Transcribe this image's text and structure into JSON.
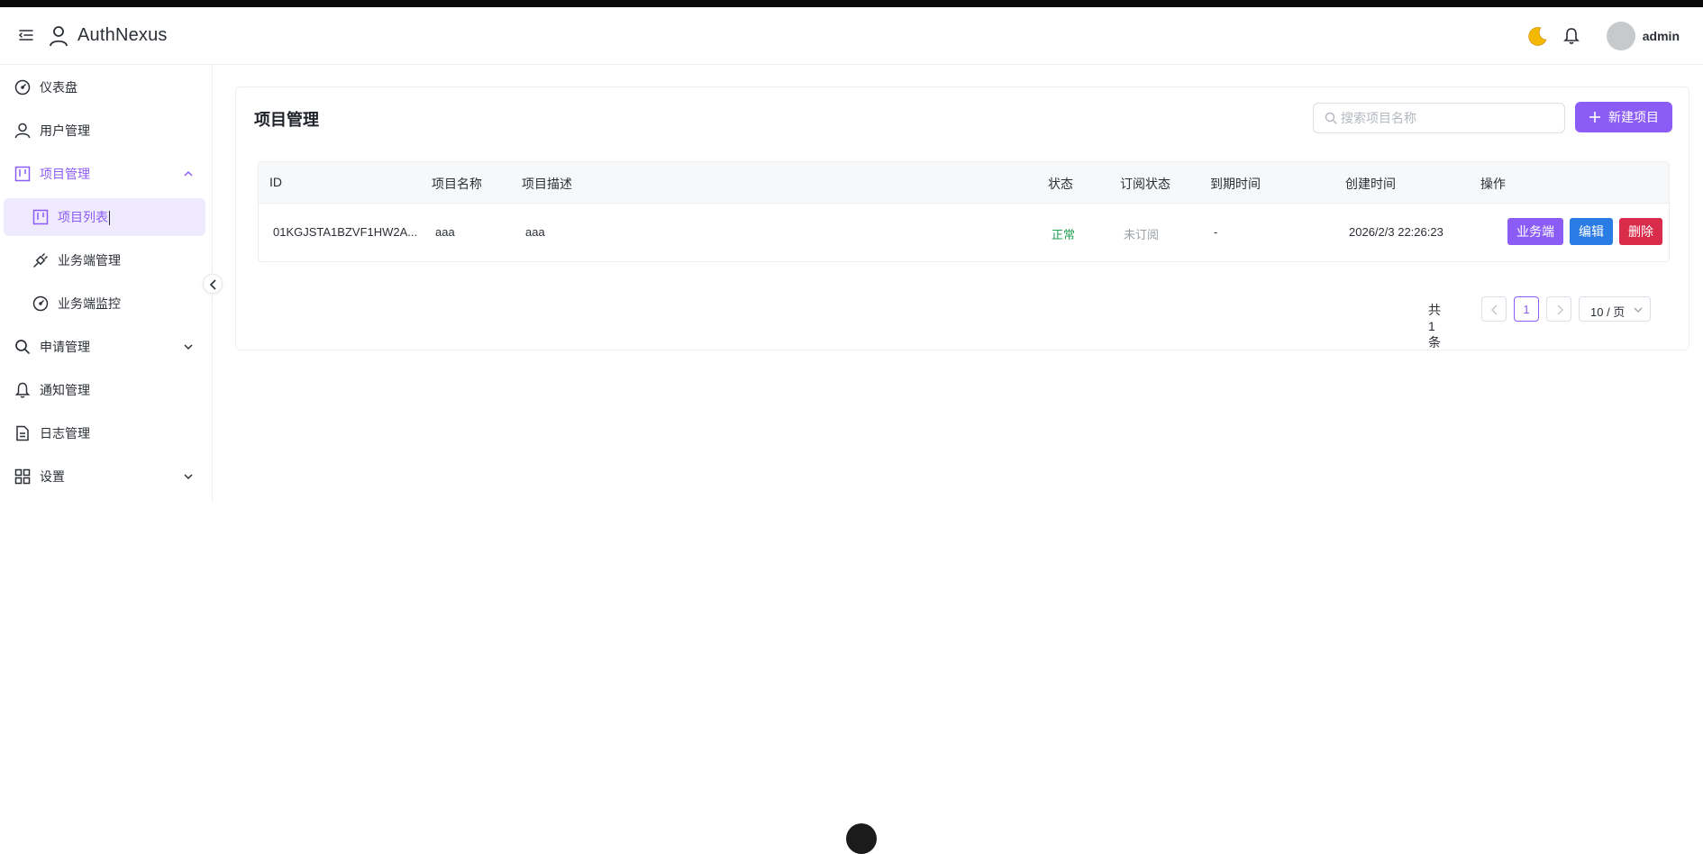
{
  "app": {
    "title": "AuthNexus",
    "user": "admin"
  },
  "sidebar": {
    "items": [
      {
        "label": "仪表盘",
        "icon": "dashboard-icon"
      },
      {
        "label": "用户管理",
        "icon": "user-icon"
      },
      {
        "label": "项目管理",
        "icon": "kanban-icon",
        "expanded": true
      },
      {
        "label": "项目列表",
        "icon": "kanban-icon",
        "active": true
      },
      {
        "label": "业务端管理",
        "icon": "plug-icon"
      },
      {
        "label": "业务端监控",
        "icon": "gauge-icon"
      },
      {
        "label": "申请管理",
        "icon": "search-icon",
        "expanded": false
      },
      {
        "label": "通知管理",
        "icon": "bell-icon"
      },
      {
        "label": "日志管理",
        "icon": "file-icon"
      },
      {
        "label": "设置",
        "icon": "grid-icon",
        "expanded": false
      }
    ]
  },
  "main": {
    "title": "项目管理",
    "search_placeholder": "搜索项目名称",
    "new_button": "新建项目",
    "table": {
      "columns": [
        "ID",
        "项目名称",
        "项目描述",
        "状态",
        "订阅状态",
        "到期时间",
        "创建时间",
        "操作"
      ],
      "rows": [
        {
          "id": "01KGJSTA1BZVF1HW2A...",
          "name": "aaa",
          "description": "aaa",
          "status": "正常",
          "subscription": "未订阅",
          "expires": "-",
          "created": "2026/2/3 22:26:23",
          "actions": [
            "业务端",
            "编辑",
            "删除"
          ]
        }
      ]
    },
    "pagination": {
      "total": "共 1 条",
      "current": "1",
      "page_size": "10 / 页"
    }
  },
  "colors": {
    "accent": "#8b5cf6",
    "edit": "#2b7be4",
    "delete": "#d92b4a",
    "status_ok": "#22a055"
  }
}
